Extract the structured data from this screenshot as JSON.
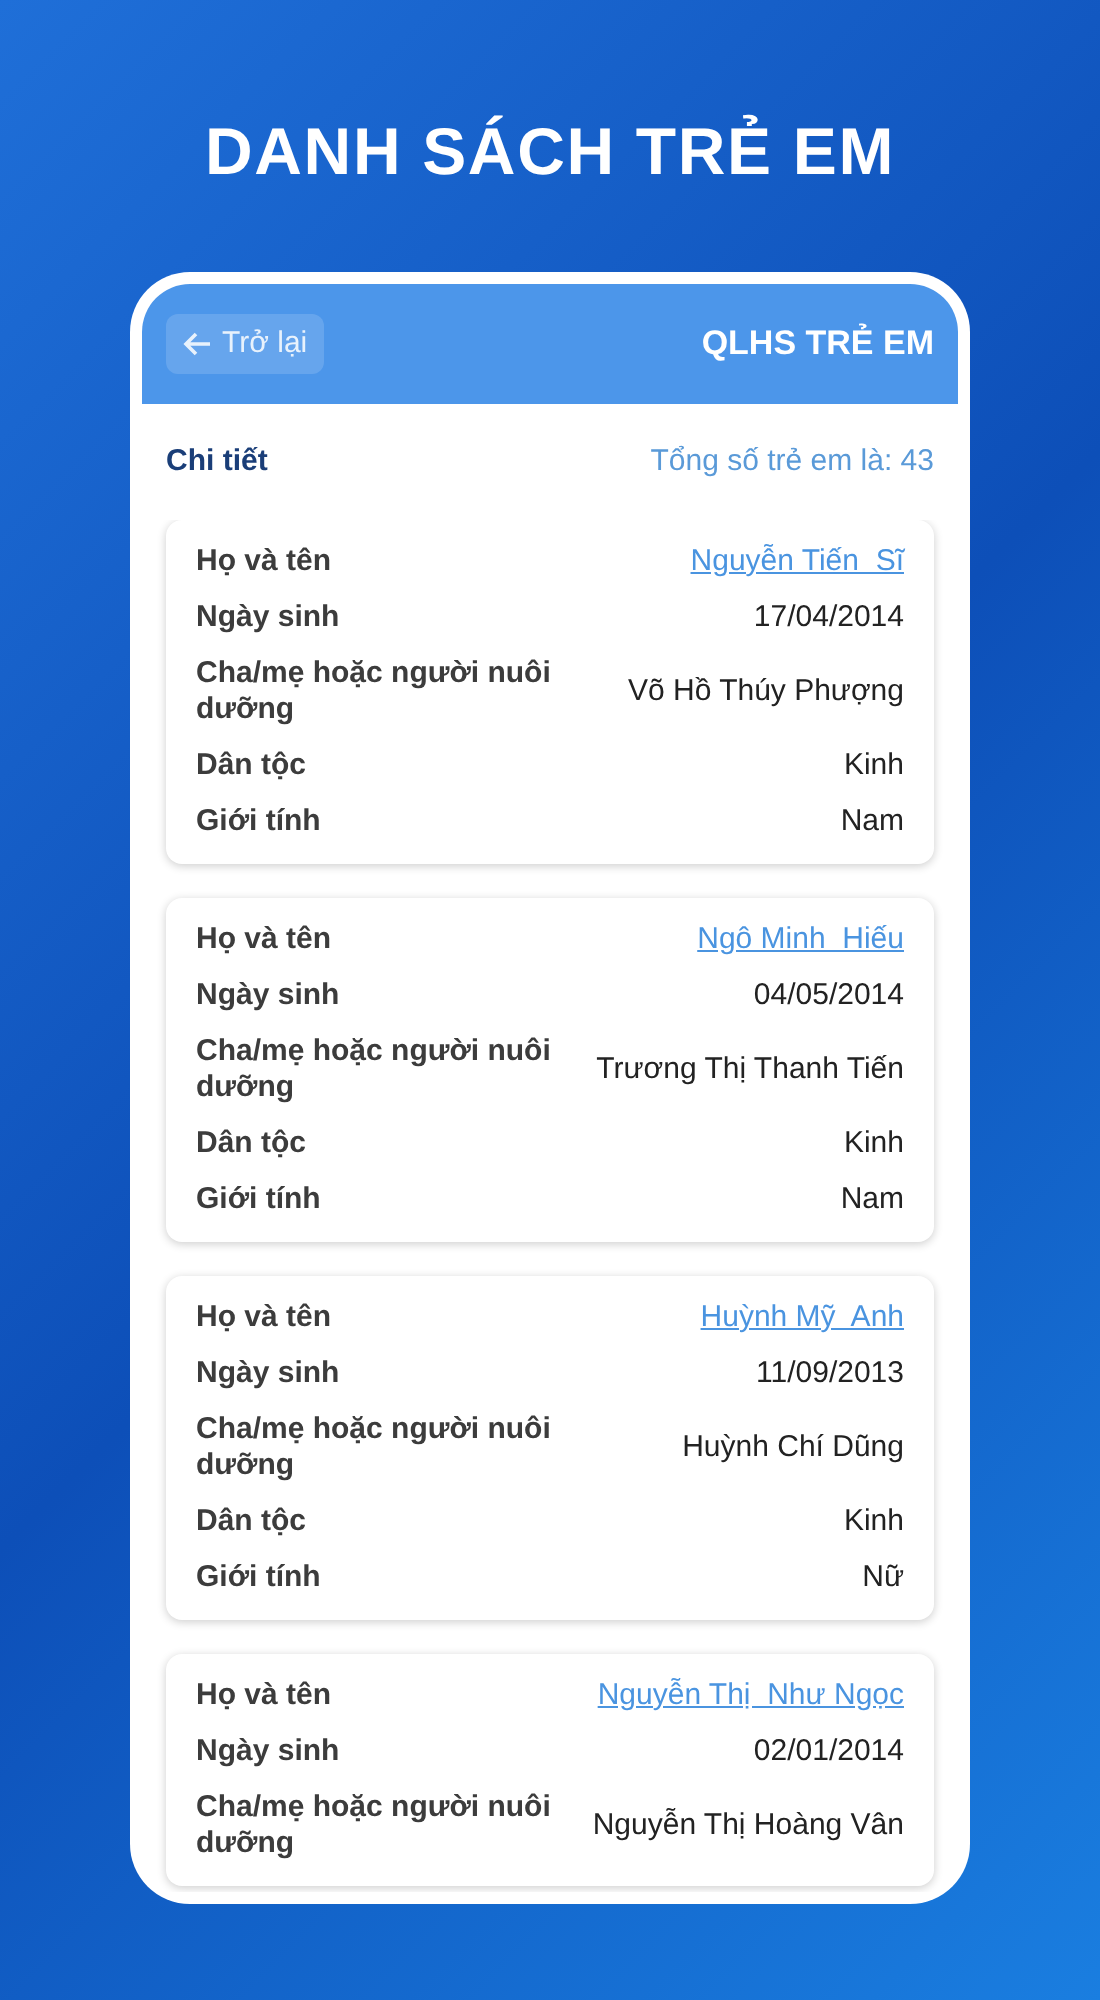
{
  "page_title": "DANH SÁCH TRẺ EM",
  "header": {
    "back_button": "Trở lại",
    "title": "QLHS TRẺ EM"
  },
  "summary": {
    "label": "Chi tiết",
    "total": "Tổng số trẻ em là: 43"
  },
  "children": [
    {
      "rows": [
        {
          "kind": "link",
          "label": "Họ và tên",
          "value": "Nguyễn Tiến  Sĩ"
        },
        {
          "kind": "text",
          "label": "Ngày sinh",
          "value": "17/04/2014"
        },
        {
          "kind": "text",
          "label": "Cha/mẹ hoặc người nuôi dưỡng",
          "value": "Võ Hồ Thúy Phượng"
        },
        {
          "kind": "text",
          "label": "Dân tộc",
          "value": "Kinh"
        },
        {
          "kind": "text",
          "label": "Giới tính",
          "value": "Nam"
        }
      ]
    },
    {
      "rows": [
        {
          "kind": "link",
          "label": "Họ và tên",
          "value": "Ngô Minh  Hiếu"
        },
        {
          "kind": "text",
          "label": "Ngày sinh",
          "value": "04/05/2014"
        },
        {
          "kind": "text",
          "label": "Cha/mẹ hoặc người nuôi dưỡng",
          "value": "Trương Thị Thanh Tiến"
        },
        {
          "kind": "text",
          "label": "Dân tộc",
          "value": "Kinh"
        },
        {
          "kind": "text",
          "label": "Giới tính",
          "value": "Nam"
        }
      ]
    },
    {
      "rows": [
        {
          "kind": "link",
          "label": "Họ và tên",
          "value": "Huỳnh Mỹ  Anh"
        },
        {
          "kind": "text",
          "label": "Ngày sinh",
          "value": "11/09/2013"
        },
        {
          "kind": "text",
          "label": "Cha/mẹ hoặc người nuôi dưỡng",
          "value": "Huỳnh Chí Dũng"
        },
        {
          "kind": "text",
          "label": "Dân tộc",
          "value": "Kinh"
        },
        {
          "kind": "text",
          "label": "Giới tính",
          "value": "Nữ"
        }
      ]
    },
    {
      "rows": [
        {
          "kind": "link",
          "label": "Họ và tên",
          "value": "Nguyễn Thị  Như Ngọc"
        },
        {
          "kind": "text",
          "label": "Ngày sinh",
          "value": "02/01/2014"
        },
        {
          "kind": "text",
          "label": "Cha/mẹ hoặc người nuôi dưỡng",
          "value": "Nguyễn Thị Hoàng Vân"
        }
      ]
    }
  ]
}
